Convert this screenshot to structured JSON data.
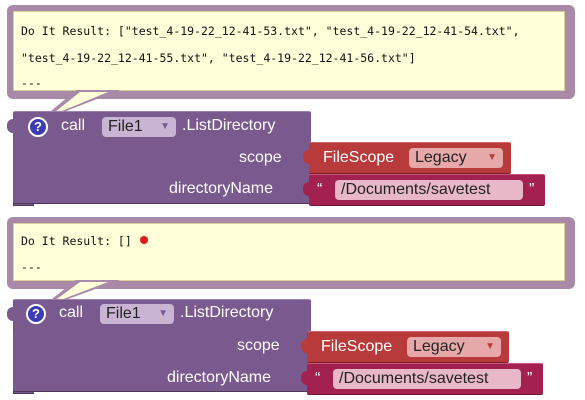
{
  "top": {
    "result_line1": "Do It Result: [\"test_4-19-22_12-41-53.txt\", \"test_4-19-22_12-41-54.txt\",",
    "result_line2": "\"test_4-19-22_12-41-55.txt\", \"test_4-19-22_12-41-56.txt\"]",
    "result_line3": "---",
    "block": {
      "call_label": "call",
      "component": "File1",
      "method": ".ListDirectory",
      "scope_label": "scope",
      "scope_block_label": "FileScope",
      "scope_value": "Legacy",
      "directory_label": "directoryName",
      "open_quote": "“",
      "directory_value": "/Documents/savetest",
      "close_quote": "”"
    }
  },
  "bottom": {
    "result_line1": "Do It Result: []",
    "result_line2": "---",
    "block": {
      "call_label": "call",
      "component": "File1",
      "method": ".ListDirectory",
      "scope_label": "scope",
      "scope_block_label": "FileScope",
      "scope_value": "Legacy",
      "directory_label": "directoryName",
      "open_quote": "“",
      "directory_value": "/Documents/savetest",
      "close_quote": "”"
    }
  },
  "icons": {
    "help": "?",
    "dropdown_arrow": "▼"
  },
  "colors": {
    "procedure_block": "#7a5a8e",
    "scope_block": "#b83a3a",
    "text_block": "#a3214f",
    "comment_bg": "#ffffd9",
    "comment_frame": "#a889a8",
    "help_icon": "#3b3bb5",
    "error_dot": "#e01818"
  }
}
